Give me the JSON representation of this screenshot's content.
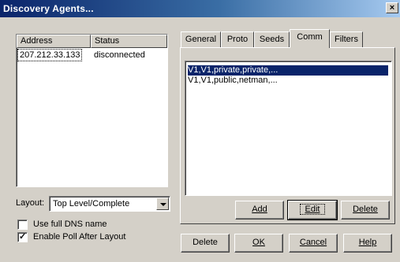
{
  "window": {
    "title": "Discovery Agents...",
    "close_glyph": "×"
  },
  "agents": {
    "columns": [
      "Address",
      "Status"
    ],
    "rows": [
      {
        "address": "207.212.33.133",
        "status": "disconnected"
      }
    ]
  },
  "layout": {
    "label": "Layout:",
    "value": "Top Level/Complete"
  },
  "options": {
    "use_full_dns": {
      "label": "Use full DNS name",
      "checked": false
    },
    "enable_poll": {
      "label": "Enable Poll After Layout",
      "checked": true
    }
  },
  "tabs": [
    "General",
    "Proto",
    "Seeds",
    "Comm",
    "Filters"
  ],
  "active_tab": "Comm",
  "comm": {
    "items": [
      "V1,V1,private,private,...",
      "V1,V1,public,netman,..."
    ],
    "selected_index": 0,
    "buttons": {
      "add": "Add",
      "edit": "Edit",
      "delete": "Delete"
    }
  },
  "footer": {
    "delete": "Delete",
    "ok": "OK",
    "cancel": "Cancel",
    "help": "Help"
  }
}
